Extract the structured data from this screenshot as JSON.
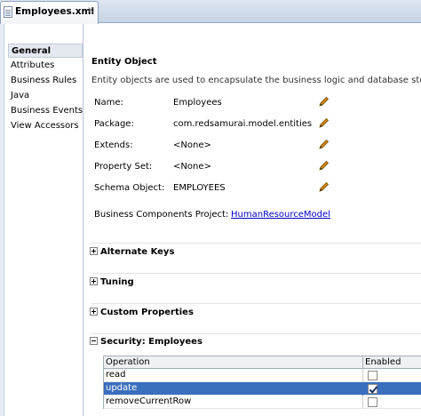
{
  "tab": {
    "title": "Employees.xml",
    "close": "×"
  },
  "nav": {
    "items": [
      {
        "label": "General",
        "selected": true
      },
      {
        "label": "Attributes"
      },
      {
        "label": "Business Rules"
      },
      {
        "label": "Java"
      },
      {
        "label": "Business Events"
      },
      {
        "label": "View Accessors"
      }
    ]
  },
  "entity": {
    "title": "Entity Object",
    "description": "Entity objects are used to encapsulate the business logic and database storage d",
    "fields": [
      {
        "label": "Name:",
        "value": "Employees"
      },
      {
        "label": "Package:",
        "value": "com.redsamurai.model.entities"
      },
      {
        "label": "Extends:",
        "value": "<None>"
      },
      {
        "label": "Property Set:",
        "value": "<None>"
      },
      {
        "label": "Schema Object:",
        "value": "EMPLOYEES"
      }
    ],
    "bcp_label": "Business Components Project:",
    "bcp_link": "HumanResourceModel"
  },
  "sections": {
    "alternate_keys": "Alternate Keys",
    "tuning": "Tuning",
    "custom_properties": "Custom Properties",
    "security": "Security: Employees"
  },
  "security_table": {
    "headers": {
      "operation": "Operation",
      "enabled": "Enabled"
    },
    "rows": [
      {
        "operation": "read",
        "enabled": false,
        "selected": false
      },
      {
        "operation": "update",
        "enabled": true,
        "selected": true
      },
      {
        "operation": "removeCurrentRow",
        "enabled": false,
        "selected": false
      }
    ]
  },
  "colors": {
    "selection": "#3a6fbd",
    "link": "#0000cc",
    "pencil": "#d08a1a"
  }
}
